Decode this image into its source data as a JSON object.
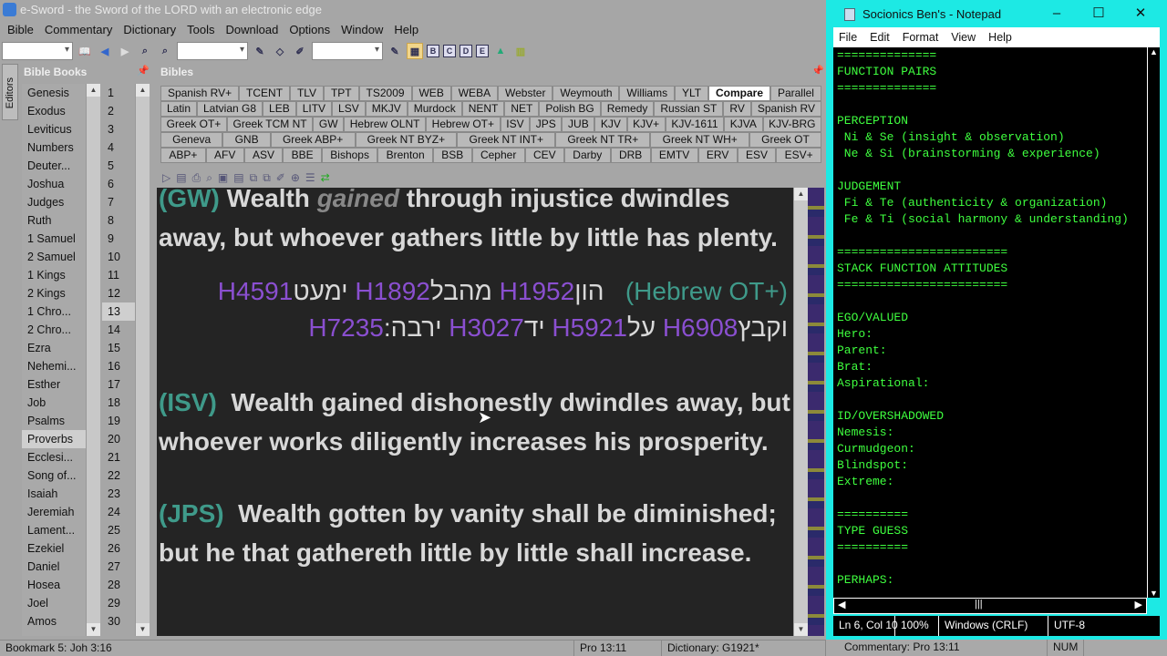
{
  "app": {
    "title": "e-Sword - the Sword of the LORD with an electronic edge"
  },
  "menu": [
    "Bible",
    "Commentary",
    "Dictionary",
    "Tools",
    "Download",
    "Options",
    "Window",
    "Help"
  ],
  "toolbar": {
    "layout_buttons": [
      "B",
      "C",
      "D",
      "E"
    ]
  },
  "editors_tab": {
    "label": "Editors",
    "icon_letter": "E"
  },
  "books_panel": {
    "title": "Bible Books",
    "books": [
      "Genesis",
      "Exodus",
      "Leviticus",
      "Numbers",
      "Deuter...",
      "Joshua",
      "Judges",
      "Ruth",
      "1 Samuel",
      "2 Samuel",
      "1 Kings",
      "2 Kings",
      "1 Chro...",
      "2 Chro...",
      "Ezra",
      "Nehemi...",
      "Esther",
      "Job",
      "Psalms",
      "Proverbs",
      "Ecclesi...",
      "Song of...",
      "Isaiah",
      "Jeremiah",
      "Lament...",
      "Ezekiel",
      "Daniel",
      "Hosea",
      "Joel",
      "Amos"
    ],
    "selected_book": "Proverbs",
    "chapters": [
      "1",
      "2",
      "3",
      "4",
      "5",
      "6",
      "7",
      "8",
      "9",
      "10",
      "11",
      "12",
      "13",
      "14",
      "15",
      "16",
      "17",
      "18",
      "19",
      "20",
      "21",
      "22",
      "23",
      "24",
      "25",
      "26",
      "27",
      "28",
      "29",
      "30"
    ],
    "selected_chapter": "13"
  },
  "bibles_panel": {
    "title": "Bibles",
    "tab_rows": [
      [
        "Spanish RV+",
        "TCENT",
        "TLV",
        "TPT",
        "TS2009",
        "WEB",
        "WEBA",
        "Webster",
        "Weymouth",
        "Williams",
        "YLT",
        "Compare",
        "Parallel"
      ],
      [
        "Latin",
        "Latvian G8",
        "LEB",
        "LITV",
        "LSV",
        "MKJV",
        "Murdock",
        "NENT",
        "NET",
        "Polish BG",
        "Remedy",
        "Russian ST",
        "RV",
        "Spanish RV"
      ],
      [
        "Greek OT+",
        "Greek TCM NT",
        "GW",
        "Hebrew OLNT",
        "Hebrew OT+",
        "ISV",
        "JPS",
        "JUB",
        "KJV",
        "KJV+",
        "KJV-1611",
        "KJVA",
        "KJV-BRG"
      ],
      [
        "Geneva",
        "GNB",
        "Greek ABP+",
        "Greek NT BYZ+",
        "Greek NT INT+",
        "Greek NT TR+",
        "Greek NT WH+",
        "Greek OT"
      ],
      [
        "ABP+",
        "AFV",
        "ASV",
        "BBE",
        "Bishops",
        "Brenton",
        "BSB",
        "Cepher",
        "CEV",
        "Darby",
        "DRB",
        "EMTV",
        "ERV",
        "ESV",
        "ESV+"
      ]
    ],
    "selected_tab": "Compare",
    "verses": {
      "gw": {
        "abbr": "(GW)",
        "text1": "Wealth ",
        "italic": "gained",
        "text2": " through injustice dwindles away, but whoever gathers little by little has plenty."
      },
      "hebrew": {
        "label": "(+Hebrew OT)",
        "line1": [
          "הון",
          "H1952",
          "מהבל",
          "H1892",
          "ימעט",
          "H4591"
        ],
        "line2": [
          "וקבץ",
          "H6908",
          "על",
          "H5921",
          "יד",
          "H3027",
          "ירבה:",
          "H7235"
        ]
      },
      "isv": {
        "abbr": "(ISV)",
        "text": "Wealth gained dishonestly dwindles away, but whoever works diligently increases his prosperity."
      },
      "jps": {
        "abbr": "(JPS)",
        "text": "Wealth gotten by vanity shall be diminished; but he that gathereth little by little shall increase."
      }
    }
  },
  "status": {
    "bookmark": "Bookmark 5: Joh 3:16",
    "verse": "Pro 13:11",
    "dictionary": "Dictionary: G1921*",
    "commentary": "Commentary: Pro 13:11",
    "num": "NUM"
  },
  "notepad": {
    "title": "Socionics Ben's - Notepad",
    "menu": [
      "File",
      "Edit",
      "Format",
      "View",
      "Help"
    ],
    "text": "==============\nFUNCTION PAIRS\n==============\n\nPERCEPTION\n Ni & Se (insight & observation)\n Ne & Si (brainstorming & experience)\n\nJUDGEMENT\n Fi & Te (authenticity & organization)\n Fe & Ti (social harmony & understanding)\n\n========================\nSTACK FUNCTION ATTITUDES\n========================\n\nEGO/VALUED\nHero:\nParent:\nBrat:\nAspirational:\n\nID/OVERSHADOWED\nNemesis:\nCurmudgeon:\nBlindspot:\nExtreme:\n\n==========\nTYPE GUESS\n==========\n\nPERHAPS:",
    "status": {
      "position": "Ln 6, Col 10",
      "zoom": "100%",
      "line_endings": "Windows (CRLF)",
      "encoding": "UTF-8"
    }
  }
}
